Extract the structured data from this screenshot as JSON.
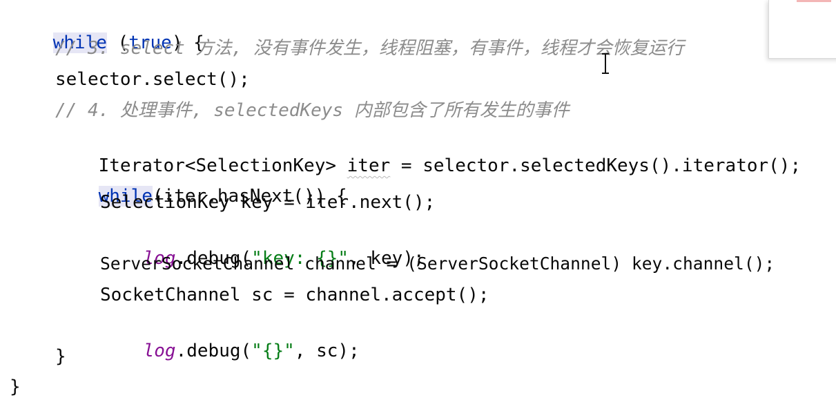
{
  "code": {
    "l1": {
      "kw1": "while",
      "p1": " (",
      "kw2": "true",
      "p2": ") {"
    },
    "l2": {
      "comment": "// 3. select 方法, 没有事件发生，线程阻塞，有事件，线程才会恢复运行"
    },
    "l3": {
      "text": "selector.select();"
    },
    "l4": {
      "comment": "// 4. 处理事件, selectedKeys 内部包含了所有发生的事件"
    },
    "l5": {
      "a": "Iterator<SelectionKey> ",
      "iter": "iter",
      "b": " = selector.selectedKeys().iterator();"
    },
    "l6": {
      "kw": "while",
      "rest": "(iter.hasNext()) {"
    },
    "l7": {
      "text": "SelectionKey key = iter.next();"
    },
    "l8": {
      "log": "log",
      "a": ".debug(",
      "str": "\"key: {}\"",
      "b": ", key);"
    },
    "l9": {
      "text": "ServerSocketChannel channel = (ServerSocketChannel) key.channel();"
    },
    "l10": {
      "text": "SocketChannel sc = channel.accept();"
    },
    "l11": {
      "log": "log",
      "a": ".debug(",
      "str": "\"{}\"",
      "b": ", sc);"
    },
    "l12": {
      "text": "}"
    },
    "l13": {
      "text": "}"
    }
  },
  "colors": {
    "keyword": "#0033b3",
    "comment": "#8c8c8c",
    "string": "#067d17",
    "field": "#871094",
    "text": "#080808"
  },
  "icons": {
    "cursor": "text-cursor-icon"
  }
}
